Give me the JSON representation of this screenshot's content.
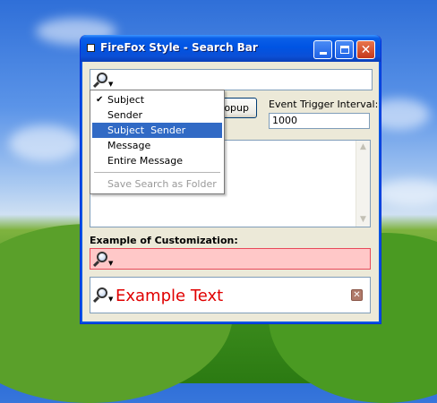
{
  "window": {
    "title": "FireFox Style - Search Bar"
  },
  "search_menu": {
    "items": [
      {
        "label": "Subject",
        "checked": true
      },
      {
        "label": "Sender"
      },
      {
        "label": "Subject  Sender",
        "highlighted": true
      },
      {
        "label": "Message"
      },
      {
        "label": "Entire Message"
      }
    ],
    "save_label": "Save Search as Folder"
  },
  "popup_button_label": "opup",
  "event_trigger": {
    "label": "Event Trigger Interval:",
    "value": "1000"
  },
  "customization": {
    "label": "Example of Customization:",
    "example_text": "Example Text"
  },
  "colors": {
    "title_bar": "#0054e3",
    "menu_highlight": "#316ac5",
    "pink_search_bg": "#ffc8c8",
    "example_text": "#e00000",
    "close_button": "#c4381c"
  },
  "icons": {
    "search": "magnifier-icon",
    "dropdown": "chevron-down-icon",
    "clear": "close-icon"
  }
}
